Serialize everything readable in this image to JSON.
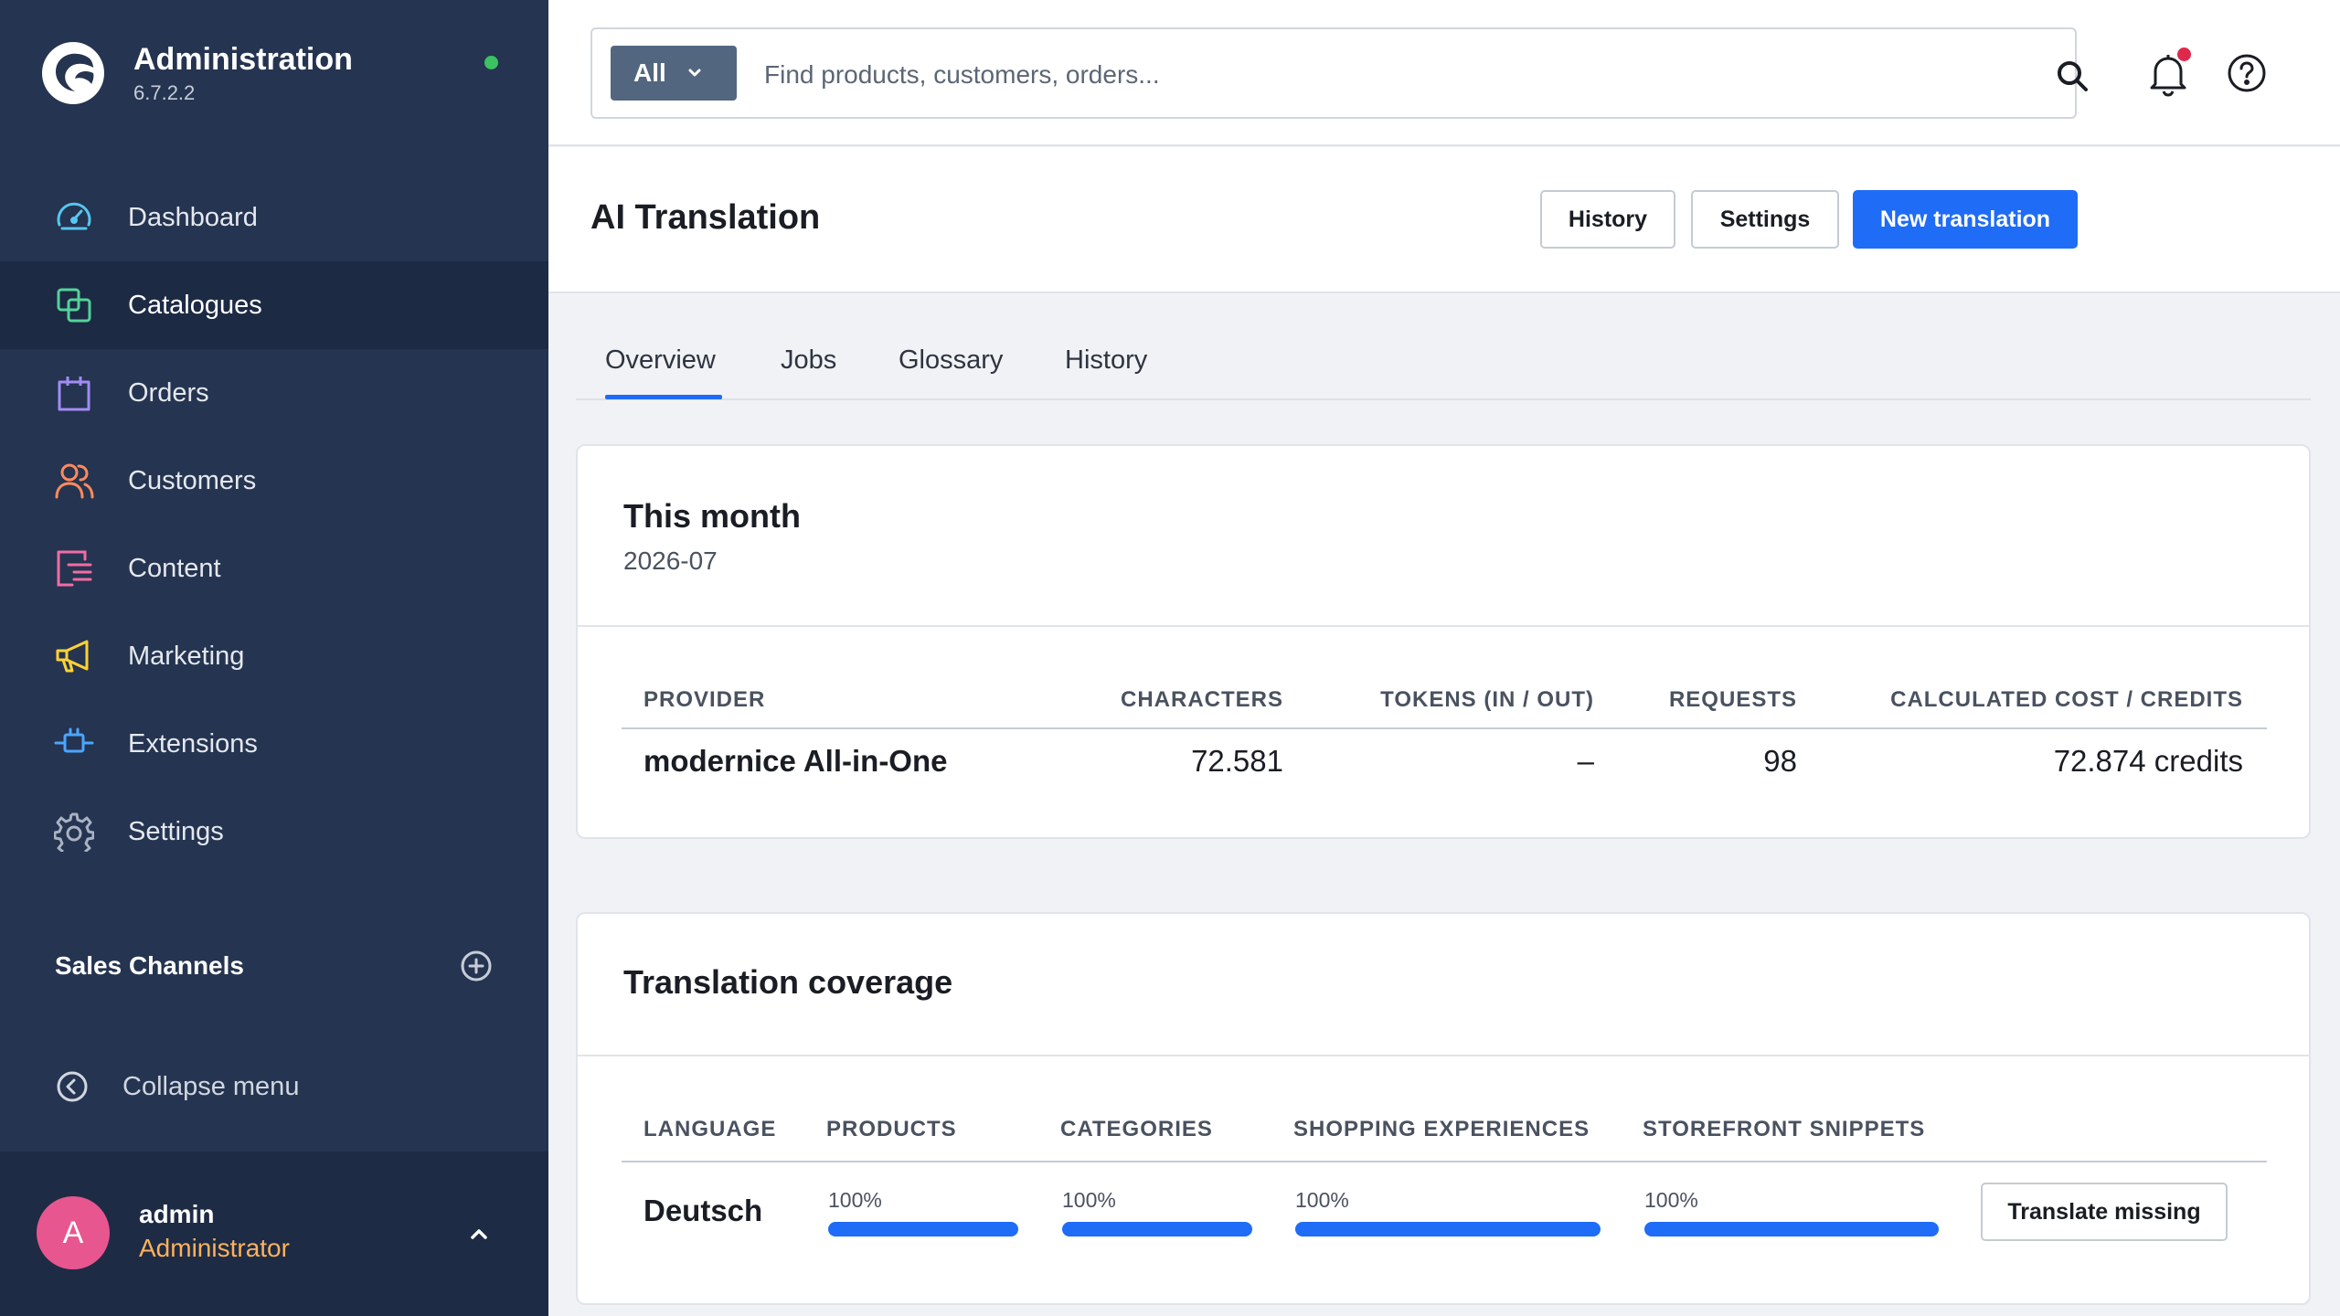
{
  "app": {
    "title": "Administration",
    "version": "6.7.2.2",
    "status_color": "#3cc261"
  },
  "sidebar": {
    "items": [
      {
        "label": "Dashboard",
        "icon": "gauge-icon",
        "color": "#56c7f0",
        "active": false
      },
      {
        "label": "Catalogues",
        "icon": "catalogue-icon",
        "color": "#53d39a",
        "active": true
      },
      {
        "label": "Orders",
        "icon": "shopping-bag-icon",
        "color": "#a18cf5",
        "active": false
      },
      {
        "label": "Customers",
        "icon": "users-icon",
        "color": "#ff8b5e",
        "active": false
      },
      {
        "label": "Content",
        "icon": "content-icon",
        "color": "#f36ca4",
        "active": false
      },
      {
        "label": "Marketing",
        "icon": "megaphone-icon",
        "color": "#ffd233",
        "active": false
      },
      {
        "label": "Extensions",
        "icon": "plug-icon",
        "color": "#4aa6ff",
        "active": false
      },
      {
        "label": "Settings",
        "icon": "gear-icon",
        "color": "#a8b2c2",
        "active": false
      }
    ],
    "sales_channels_label": "Sales Channels",
    "collapse_label": "Collapse menu",
    "user": {
      "initial": "A",
      "name": "admin",
      "role": "Administrator"
    }
  },
  "topbar": {
    "search_scope": "All",
    "search_placeholder": "Find products, customers, orders...",
    "notification_dot_color": "#de294c"
  },
  "page": {
    "title": "AI Translation",
    "buttons": {
      "history": "History",
      "settings": "Settings",
      "new_translation": "New translation"
    },
    "tabs": [
      "Overview",
      "Jobs",
      "Glossary",
      "History"
    ],
    "active_tab": "Overview"
  },
  "usage_card": {
    "title": "This month",
    "period": "2026-07",
    "columns": {
      "provider": "PROVIDER",
      "characters": "CHARACTERS",
      "tokens": "TOKENS (IN / OUT)",
      "requests": "REQUESTS",
      "cost": "CALCULATED COST / CREDITS"
    },
    "rows": [
      {
        "provider": "modernice All-in-One",
        "characters": "72.581",
        "tokens": "–",
        "requests": "98",
        "cost": "72.874 credits"
      }
    ]
  },
  "coverage_card": {
    "title": "Translation coverage",
    "columns": {
      "language": "LANGUAGE",
      "products": "PRODUCTS",
      "categories": "CATEGORIES",
      "shopping_experiences": "SHOPPING EXPERIENCES",
      "storefront_snippets": "STOREFRONT SNIPPETS"
    },
    "rows": [
      {
        "language": "Deutsch",
        "products": {
          "label": "100%",
          "value": 100
        },
        "categories": {
          "label": "100%",
          "value": 100
        },
        "shopping_experiences": {
          "label": "100%",
          "value": 100
        },
        "storefront_snippets": {
          "label": "100%",
          "value": 100
        },
        "action": "Translate missing"
      }
    ]
  }
}
